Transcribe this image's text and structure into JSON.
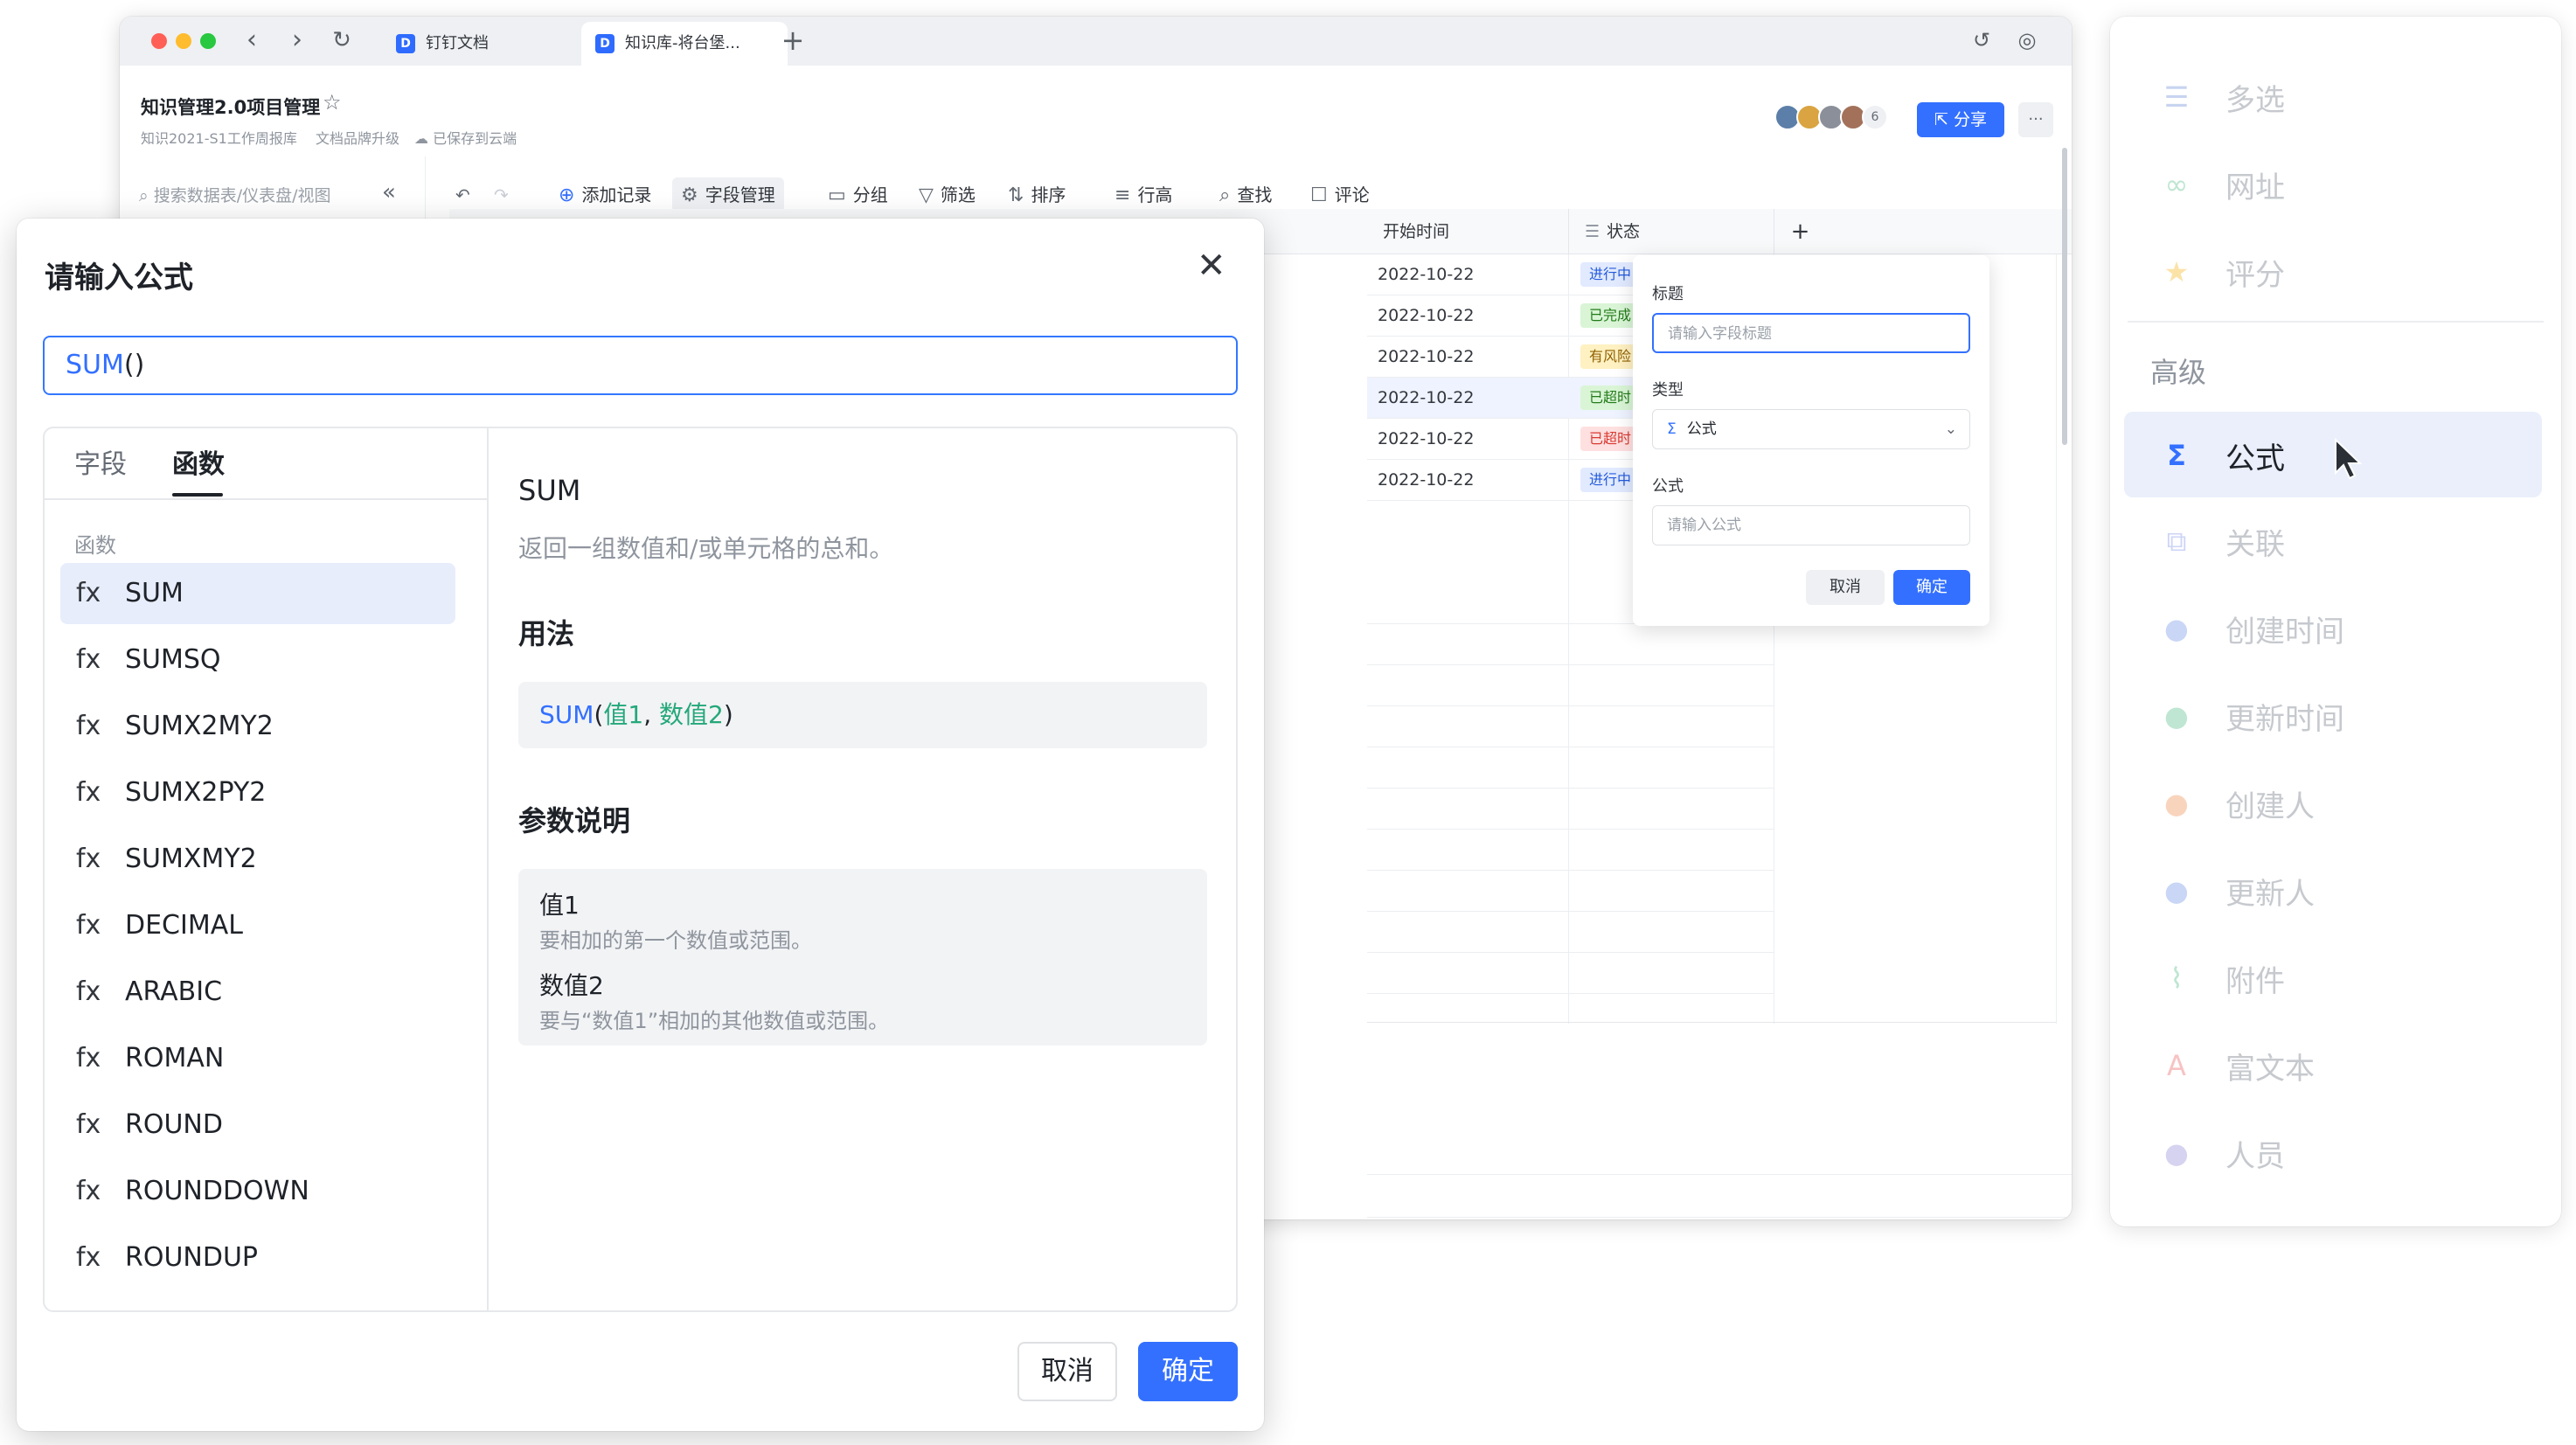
{
  "browser": {
    "tabs": [
      {
        "title": "钉钉文档",
        "icon": "doc-icon"
      },
      {
        "title": "知识库-将台堡...",
        "icon": "doc-icon"
      }
    ],
    "new_tab": "+",
    "doc": {
      "title": "知识管理2.0项目管理",
      "crumb1": "知识2021-S1工作周报库",
      "crumb2": "文档品牌升级",
      "saved": "已保存到云端",
      "avatar_count": "6",
      "share_label": "分享",
      "more_label": "···"
    },
    "search_placeholder": "搜索数据表/仪表盘/视图",
    "toolbar": {
      "add_record": "添加记录",
      "field_manage": "字段管理",
      "group": "分组",
      "filter": "筛选",
      "sort": "排序",
      "row_height": "行高",
      "find": "查找",
      "comment": "评论"
    },
    "grid": {
      "col_start": "开始时间",
      "col_status": "状态",
      "add_col": "+",
      "rows": [
        {
          "date": "2022-10-22",
          "status": "进行中",
          "tone": "blue"
        },
        {
          "date": "2022-10-22",
          "status": "已完成",
          "tone": "green"
        },
        {
          "date": "2022-10-22",
          "status": "有风险",
          "tone": "yellow"
        },
        {
          "date": "2022-10-22",
          "status": "已超时",
          "tone": "green"
        },
        {
          "date": "2022-10-22",
          "status": "已超时",
          "tone": "red"
        },
        {
          "date": "2022-10-22",
          "status": "进行中",
          "tone": "blue"
        }
      ]
    },
    "field_popup": {
      "title_label": "标题",
      "title_placeholder": "请输入字段标题",
      "type_label": "类型",
      "type_value": "公式",
      "formula_label": "公式",
      "formula_placeholder": "请输入公式",
      "cancel": "取消",
      "confirm": "确定"
    }
  },
  "dialog": {
    "title": "请输入公式",
    "formula_fn": "SUM",
    "formula_rest": "()",
    "tabs": {
      "fields": "字段",
      "functions": "函数"
    },
    "list_header": "函数",
    "fx": "fx",
    "functions": [
      "SUM",
      "SUMSQ",
      "SUMX2MY2",
      "SUMX2PY2",
      "SUMXMY2",
      "DECIMAL",
      "ARABIC",
      "ROMAN",
      "ROUND",
      "ROUNDDOWN",
      "ROUNDUP"
    ],
    "detail": {
      "name": "SUM",
      "description": "返回一组数值和/或单元格的总和。",
      "usage_title": "用法",
      "usage_fn": "SUM",
      "usage_open": "(",
      "usage_arg1": "值1",
      "usage_sep": ", ",
      "usage_arg2": "数值2",
      "usage_close": ")",
      "params_title": "参数说明",
      "params": [
        {
          "name": "值1",
          "desc": "要相加的第一个数值或范围。"
        },
        {
          "name": "数值2",
          "desc": "要与“数值1”相加的其他数值或范围。"
        }
      ]
    },
    "cancel": "取消",
    "confirm": "确定"
  },
  "field_types": {
    "section_advanced": "高级",
    "items_top": [
      {
        "label": "多选",
        "icon": "list-icon",
        "color": "#c8d4f0"
      },
      {
        "label": "网址",
        "icon": "link-icon",
        "color": "#bfe6d2"
      },
      {
        "label": "评分",
        "icon": "star-icon",
        "color": "#fbe3a8"
      }
    ],
    "formula_item": {
      "label": "公式",
      "icon": "sigma-icon",
      "color": "#3370ff"
    },
    "items_bottom": [
      {
        "label": "关联",
        "icon": "relation-icon",
        "color": "#cdd4f7"
      },
      {
        "label": "创建时间",
        "icon": "clock-icon",
        "color": "#c9d6f5"
      },
      {
        "label": "更新时间",
        "icon": "clock-icon",
        "color": "#bfe6d2"
      },
      {
        "label": "创建人",
        "icon": "person-icon",
        "color": "#f9d4bd"
      },
      {
        "label": "更新人",
        "icon": "person-icon",
        "color": "#c9d6f5"
      },
      {
        "label": "附件",
        "icon": "paperclip-icon",
        "color": "#bfe6d2"
      },
      {
        "label": "富文本",
        "icon": "richtext-icon",
        "color": "#f7c3c3"
      },
      {
        "label": "人员",
        "icon": "person-icon",
        "color": "#d6d3f0"
      }
    ]
  },
  "colors": {
    "accent": "#3370ff",
    "selected_bg": "#e7edfb",
    "panel_selected_bg": "#eaeffb"
  }
}
